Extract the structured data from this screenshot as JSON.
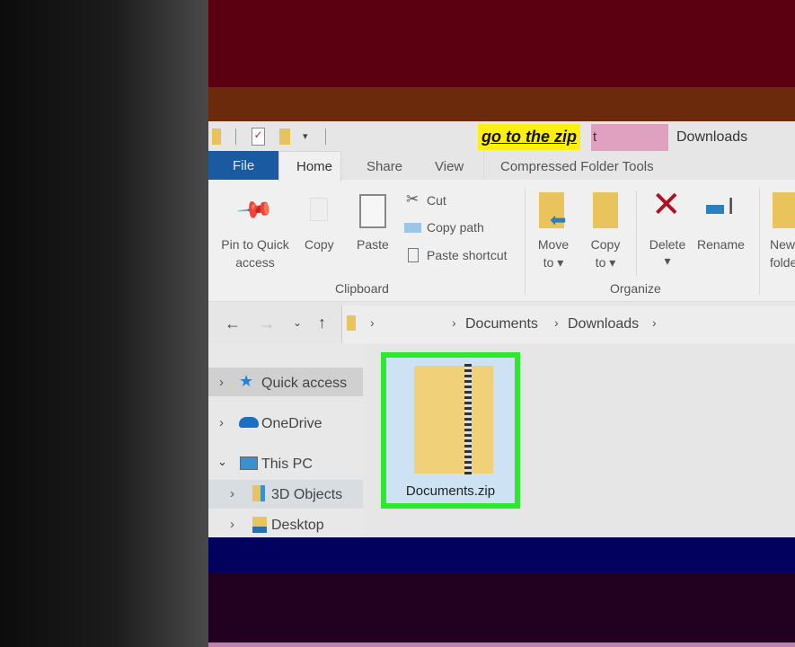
{
  "caption": "go to the zip",
  "window_title": "Downloads",
  "title_partial": "t",
  "tabs": {
    "file": "File",
    "home": "Home",
    "share": "Share",
    "view": "View",
    "compressed": "Compressed Folder Tools"
  },
  "ribbon": {
    "pin": "Pin to Quick",
    "pin2": "access",
    "copy": "Copy",
    "paste": "Paste",
    "cut": "Cut",
    "copy_path": "Copy path",
    "paste_shortcut": "Paste shortcut",
    "clipboard": "Clipboard",
    "move": "Move",
    "move2": "to",
    "copyto": "Copy",
    "copyto2": "to",
    "delete": "Delete",
    "rename": "Rename",
    "new": "New",
    "new2": "folder",
    "organize": "Organize"
  },
  "address": {
    "crumbs": [
      "Documents",
      "Downloads"
    ]
  },
  "nav": {
    "quick": "Quick access",
    "onedrive": "OneDrive",
    "thispc": "This PC",
    "objects": "3D Objects",
    "desktop": "Desktop"
  },
  "file": {
    "name": "Documents.zip"
  },
  "colors": {
    "highlight": "#2ee830",
    "file_tab": "#1a5aa0",
    "caption_bg": "#ffef10"
  }
}
